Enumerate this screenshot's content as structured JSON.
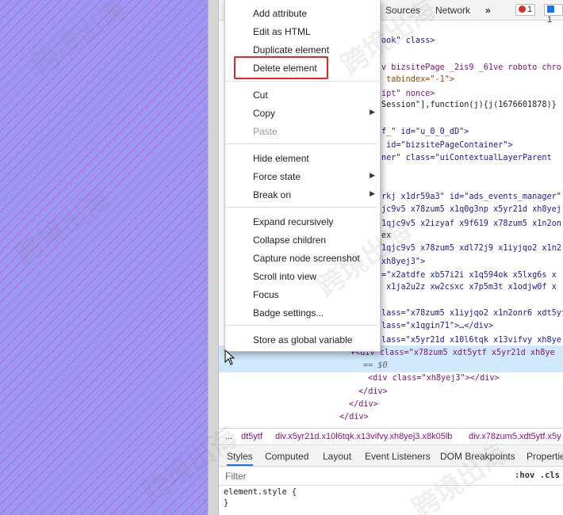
{
  "devtools": {
    "tabs": [
      "Sources",
      "Network",
      "»"
    ],
    "error_count": "1",
    "message_count": "1"
  },
  "code_lines": [
    "ook\" class>",
    "v bizsitePage _2is9 _61ve roboto chro",
    " tabindex=\"-1\">",
    "ipt\" nonce>",
    "Session\"],function(j){j(1676601878)}",
    "f_\" id=\"u_0_0_dD\">",
    " id=\"bizsitePageContainer\">",
    "ner\" class=\"uiContextualLayerParent",
    "rkj x1dr59a3\" id=\"ads_events_manager\"",
    "jc9v5 x78zum5 x1q0g3np x5yr21d xh8yej",
    "1qjc9v5 x2izyaf x9f619 x78zum5 x1n2on",
    "ex",
    "1qjc9v5 x78zum5 xdl72j9 x1iyjqo2 x1n2",
    "xh8yej3\">",
    "=\"x2atdfe xb57i2i x1q594ok x5lxg6s x",
    " x1ja2u2z xw2csxc x7p5m3t x1odjw0f x",
    "lass=\"x78zum5 x1iyjqo2 x1n2onr6 xdt5yt",
    "lass=\"x1qgin71\">…</div>",
    "lass=\"x5yr21d x10l6tqk x13vifvy xh8ye",
    "▾<div class=\"x78zum5 xdt5ytf x5yr21d xh8ye",
    "== $0",
    "<div class=\"xh8yej3\"></div>",
    "</div>",
    "</div>",
    "</div>"
  ],
  "breadcrumbs": [
    "...",
    "dt5ytf",
    "div.x5yr21d.x10l6tqk.x13vifvy.xh8yej3.x8k05lb",
    "div.x78zum5.xdt5ytf.x5y"
  ],
  "panel_tabs": [
    "Styles",
    "Computed",
    "Layout",
    "Event Listeners",
    "DOM Breakpoints",
    "Properties"
  ],
  "filter_placeholder": "Filter",
  "filter_tools": ":hov  .cls",
  "styles_lines": [
    "element.style {",
    "}"
  ],
  "menu": {
    "items": [
      {
        "label": "Add attribute"
      },
      {
        "label": "Edit as HTML"
      },
      {
        "label": "Duplicate element"
      },
      {
        "label": "Delete element",
        "highlighted": true
      },
      {
        "label": "Cut"
      },
      {
        "label": "Copy",
        "submenu": true
      },
      {
        "label": "Paste",
        "disabled": true
      },
      {
        "label": "Hide element"
      },
      {
        "label": "Force state",
        "submenu": true
      },
      {
        "label": "Break on",
        "submenu": true
      },
      {
        "label": "Expand recursively"
      },
      {
        "label": "Collapse children"
      },
      {
        "label": "Capture node screenshot"
      },
      {
        "label": "Scroll into view"
      },
      {
        "label": "Focus"
      },
      {
        "label": "Badge settings..."
      },
      {
        "label": "Store as global variable"
      }
    ],
    "highlight_color": "#e8221f"
  },
  "watermark": "跨境出海"
}
